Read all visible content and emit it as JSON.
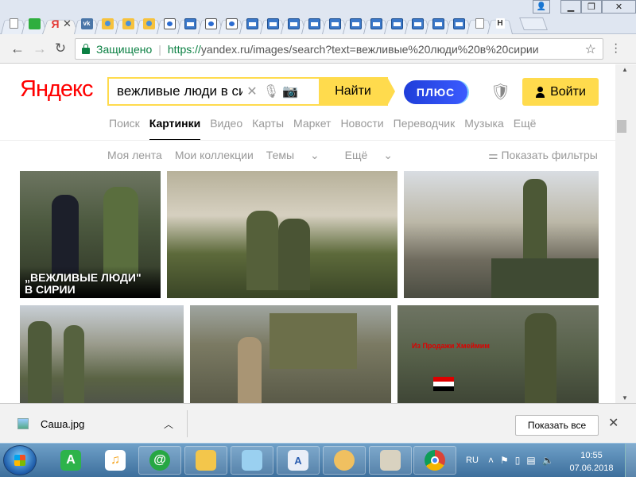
{
  "browser": {
    "tabs": [
      {
        "icon": "document-icon",
        "active": false
      },
      {
        "icon": "green-square-icon",
        "active": false
      },
      {
        "icon": "yandex-icon",
        "active": true,
        "glyph": "Я"
      },
      {
        "icon": "vk-icon",
        "glyph": "vk"
      },
      {
        "icon": "avatar-icon"
      },
      {
        "icon": "avatar-icon"
      },
      {
        "icon": "avatar-icon"
      },
      {
        "icon": "video-icon"
      },
      {
        "icon": "window-icon"
      },
      {
        "icon": "video-icon"
      },
      {
        "icon": "video-icon"
      },
      {
        "icon": "window-icon"
      },
      {
        "icon": "window-icon"
      },
      {
        "icon": "window-icon"
      },
      {
        "icon": "window-icon"
      },
      {
        "icon": "window-icon"
      },
      {
        "icon": "window-icon"
      },
      {
        "icon": "window-icon"
      },
      {
        "icon": "window-icon"
      },
      {
        "icon": "window-icon"
      },
      {
        "icon": "window-icon"
      },
      {
        "icon": "window-icon"
      },
      {
        "icon": "document-icon"
      },
      {
        "icon": "text-icon",
        "glyph": "H"
      }
    ],
    "secure_label": "Защищено",
    "url_scheme": "https://",
    "url_rest": "yandex.ru/images/search?text=вежливые%20люди%20в%20сирии"
  },
  "yandex": {
    "logo": "Яндекс",
    "search_value": "вежливые люди в сирии",
    "find_label": "Найти",
    "plus_label": "ПЛЮС",
    "login_label": "Войти",
    "services": [
      {
        "label": "Поиск",
        "active": false
      },
      {
        "label": "Картинки",
        "active": true
      },
      {
        "label": "Видео",
        "active": false
      },
      {
        "label": "Карты",
        "active": false
      },
      {
        "label": "Маркет",
        "active": false
      },
      {
        "label": "Новости",
        "active": false
      },
      {
        "label": "Переводчик",
        "active": false
      },
      {
        "label": "Музыка",
        "active": false
      },
      {
        "label": "Ещё",
        "active": false
      }
    ],
    "subnav": [
      "Моя лента",
      "Мои коллекции",
      "Темы",
      "Ещё"
    ],
    "filters_label": "Показать фильтры",
    "image_caption_1": "„ВЕЖЛИВЫЕ ЛЮДИ\"",
    "image_caption_2": "В СИРИИ",
    "image_overlay_text": "Из Продажи Хмеймим"
  },
  "download": {
    "filename": "Саша.jpg",
    "show_all_label": "Показать все"
  },
  "taskbar": {
    "lang": "RU",
    "time": "10:55",
    "date": "07.06.2018"
  },
  "colors": {
    "yandex_yellow": "#ffdb4d",
    "yandex_red": "#ff0000",
    "secure_green": "#0b8043",
    "plus_blue": "#1f3ed9"
  }
}
